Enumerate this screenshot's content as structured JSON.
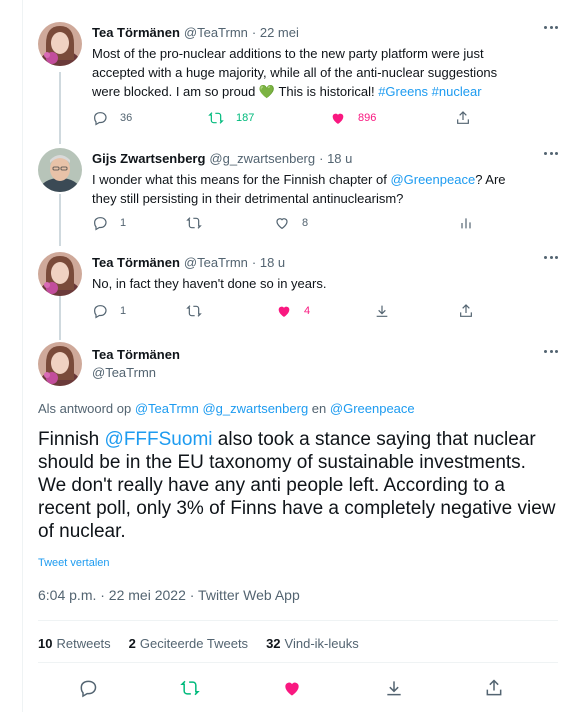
{
  "tweets": [
    {
      "name": "Tea Törmänen",
      "handle": "@TeaTrmn",
      "date": "· 22 mei",
      "text_parts": [
        "Most of the pro-nuclear additions to the new party platform were just accepted with a huge majority, while all of the anti-nuclear suggestions were blocked. I am so proud ",
        "💚",
        " This is historical! ",
        "#Greens #nuclear"
      ],
      "replies": "36",
      "retweets": "187",
      "likes": "896"
    },
    {
      "name": "Gijs Zwartsenberg",
      "handle": "@g_zwartsenberg",
      "date": "· 18 u",
      "text_parts": [
        "I wonder what this means for the Finnish chapter of ",
        "@Greenpeace",
        "? Are they still persisting in their detrimental antinuclearism?"
      ],
      "replies": "1",
      "likes": "8"
    },
    {
      "name": "Tea Törmänen",
      "handle": "@TeaTrmn",
      "date": "· 18 u",
      "text": "No, in fact they haven't done so in years.",
      "replies": "1",
      "likes": "4"
    }
  ],
  "main": {
    "name": "Tea Törmänen",
    "handle": "@TeaTrmn",
    "reply_prefix": "Als antwoord op",
    "reply_handles": "@TeaTrmn @g_zwartsenberg",
    "reply_and": "en",
    "reply_last": "@Greenpeace",
    "text_link": "@FFFSuomi",
    "text_pre": "Finnish ",
    "text_post": "  also took a stance saying that nuclear should be in the EU taxonomy of sustainable investments. We don't really have any anti people left. According to a recent poll, only 3% of Finns have a completely negative view of nuclear.",
    "translate": "Tweet vertalen",
    "timestamp": "6:04 p.m. · 22 mei 2022 · Twitter Web App",
    "retweets_count": "10",
    "retweets_label": "Retweets",
    "quotes_count": "2",
    "quotes_label": "Geciteerde Tweets",
    "likes_count": "32",
    "likes_label": "Vind-ik-leuks"
  },
  "colors": {
    "link": "#1d9bf0",
    "retweet_green": "#00ba7c",
    "like_pink": "#f91880",
    "muted": "#536471"
  },
  "icons": [
    "reply-icon",
    "retweet-icon",
    "like-icon",
    "share-icon",
    "analytics-icon",
    "more-icon",
    "heart-emoji"
  ]
}
